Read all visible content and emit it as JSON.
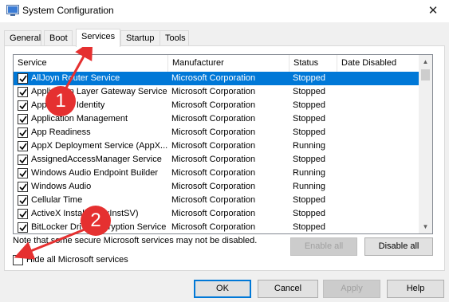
{
  "window": {
    "title": "System Configuration",
    "close_symbol": "✕"
  },
  "tabs": [
    {
      "label": "General",
      "active": false
    },
    {
      "label": "Boot",
      "active": false
    },
    {
      "label": "Services",
      "active": true
    },
    {
      "label": "Startup",
      "active": false
    },
    {
      "label": "Tools",
      "active": false
    }
  ],
  "columns": [
    "Service",
    "Manufacturer",
    "Status",
    "Date Disabled"
  ],
  "rows": [
    {
      "service": "AllJoyn Router Service",
      "manufacturer": "Microsoft Corporation",
      "status": "Stopped",
      "date": "",
      "checked": true,
      "selected": true
    },
    {
      "service": "Application Layer Gateway Service",
      "manufacturer": "Microsoft Corporation",
      "status": "Stopped",
      "date": "",
      "checked": true
    },
    {
      "service": "Application Identity",
      "manufacturer": "Microsoft Corporation",
      "status": "Stopped",
      "date": "",
      "checked": true
    },
    {
      "service": "Application Management",
      "manufacturer": "Microsoft Corporation",
      "status": "Stopped",
      "date": "",
      "checked": true
    },
    {
      "service": "App Readiness",
      "manufacturer": "Microsoft Corporation",
      "status": "Stopped",
      "date": "",
      "checked": true
    },
    {
      "service": "AppX Deployment Service (AppX...",
      "manufacturer": "Microsoft Corporation",
      "status": "Running",
      "date": "",
      "checked": true
    },
    {
      "service": "AssignedAccessManager Service",
      "manufacturer": "Microsoft Corporation",
      "status": "Stopped",
      "date": "",
      "checked": true
    },
    {
      "service": "Windows Audio Endpoint Builder",
      "manufacturer": "Microsoft Corporation",
      "status": "Running",
      "date": "",
      "checked": true
    },
    {
      "service": "Windows Audio",
      "manufacturer": "Microsoft Corporation",
      "status": "Running",
      "date": "",
      "checked": true
    },
    {
      "service": "Cellular Time",
      "manufacturer": "Microsoft Corporation",
      "status": "Stopped",
      "date": "",
      "checked": true
    },
    {
      "service": "ActiveX Installer (AxInstSV)",
      "manufacturer": "Microsoft Corporation",
      "status": "Stopped",
      "date": "",
      "checked": true
    },
    {
      "service": "BitLocker Drive Encryption Service",
      "manufacturer": "Microsoft Corporation",
      "status": "Stopped",
      "date": "",
      "checked": true
    }
  ],
  "note": "Note that some secure Microsoft services may not be disabled.",
  "buttons": {
    "enable_all": "Enable all",
    "disable_all": "Disable all",
    "ok": "OK",
    "cancel": "Cancel",
    "apply": "Apply",
    "help": "Help"
  },
  "hide_ms": {
    "label": "Hide all Microsoft services",
    "checked": false
  },
  "annotations": [
    "1",
    "2"
  ],
  "colors": {
    "selection": "#0078d7",
    "annotation": "#e53030"
  }
}
